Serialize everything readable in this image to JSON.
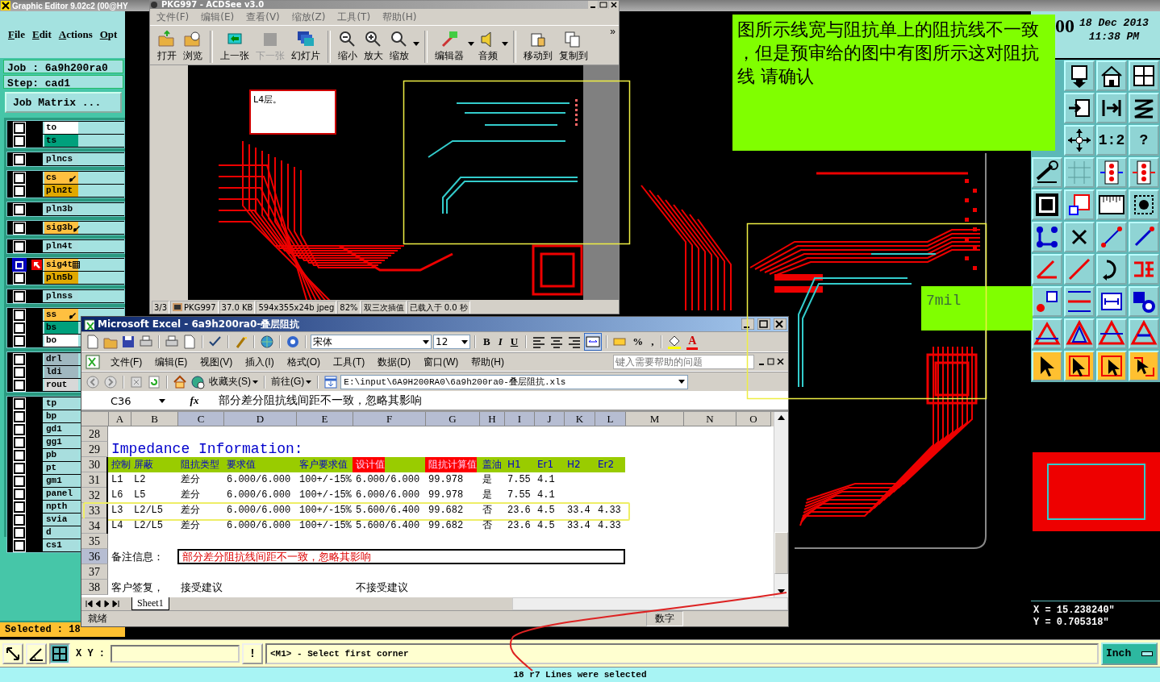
{
  "cad": {
    "title": "Graphic Editor 9.02c2 (00@HY",
    "menu": [
      "File",
      "Edit",
      "Actions",
      "Opt"
    ],
    "clock_fragment": "00",
    "date": "18 Dec 2013",
    "time": "11:38 PM",
    "job": "Job : 6a9h200ra0",
    "step": "Step: cad1",
    "job_matrix": "Job Matrix ...",
    "layer_groups": [
      [
        {
          "name": "to",
          "color": "#ffffff",
          "kind": "plain",
          "selected": false
        },
        {
          "name": "ts",
          "color": "#00a07c",
          "kind": "plain",
          "selected": false
        }
      ],
      [
        {
          "name": "plncs",
          "color": "#a8dede",
          "kind": "plain",
          "selected": false
        }
      ],
      [
        {
          "name": "cs",
          "color": "#ffc040",
          "kind": "pen",
          "selected": false
        },
        {
          "name": "pln2t",
          "color": "#e0a800",
          "kind": "plain",
          "selected": false
        }
      ],
      [
        {
          "name": "pln3b",
          "color": "#a8dede",
          "kind": "plain",
          "selected": false
        }
      ],
      [
        {
          "name": "sig3b",
          "color": "#ffc040",
          "kind": "pen",
          "selected": false
        }
      ],
      [
        {
          "name": "pln4t",
          "color": "#a8dede",
          "kind": "plain",
          "selected": false
        }
      ],
      [
        {
          "name": "sig4t",
          "color": "#ffc040",
          "kind": "grid",
          "selected": true
        },
        {
          "name": "pln5b",
          "color": "#e0a800",
          "kind": "plain",
          "selected": false
        }
      ],
      [
        {
          "name": "plnss",
          "color": "#a8dede",
          "kind": "plain",
          "selected": false
        }
      ],
      [
        {
          "name": "ss",
          "color": "#ffc040",
          "kind": "pen",
          "selected": false
        },
        {
          "name": "bs",
          "color": "#00a07c",
          "kind": "plain",
          "selected": false
        },
        {
          "name": "bo",
          "color": "#ffffff",
          "kind": "plain",
          "selected": false
        }
      ],
      [
        {
          "name": "drl",
          "color": "#a0b8c0",
          "selected": false
        },
        {
          "name": "ldi",
          "color": "#a0b8c0",
          "selected": false
        },
        {
          "name": "rout",
          "color": "#d8d8d8",
          "selected": false
        }
      ],
      [
        {
          "name": "tp",
          "color": "#a8dede",
          "selected": false
        },
        {
          "name": "bp",
          "color": "#a8dede",
          "selected": false
        },
        {
          "name": "gd1",
          "color": "#a8dede",
          "selected": false
        },
        {
          "name": "gg1",
          "color": "#a8dede",
          "selected": false
        },
        {
          "name": "pb",
          "color": "#a8dede",
          "selected": false
        },
        {
          "name": "pt",
          "color": "#a8dede",
          "selected": false
        },
        {
          "name": "gm1",
          "color": "#a8dede",
          "selected": false
        },
        {
          "name": "panel",
          "color": "#a8dede",
          "selected": false
        },
        {
          "name": "npth",
          "color": "#a8dede",
          "selected": false
        },
        {
          "name": "svia",
          "color": "#a8dede",
          "selected": false
        },
        {
          "name": "d",
          "color": "#a8dede",
          "selected": false
        },
        {
          "name": "cs1",
          "color": "#a8dede",
          "selected": false
        }
      ]
    ],
    "tool_labels": {
      "scale": "1:2",
      "help": "?"
    },
    "selected_count": "Selected : 18",
    "x_coord": "X = 15.238240\"",
    "y_coord": "Y = 0.705318\"",
    "xy_label": "X Y :",
    "alert": "!",
    "prompt": "<M1> - Select first corner",
    "units": "Inch",
    "status": "18 r7 Lines were selected"
  },
  "note": {
    "text": "图所示线宽与阻抗单上的阻抗线不一致，但是预审给的图中有图所示这对阻抗线  请确认"
  },
  "width_label": {
    "text": "7mil"
  },
  "acdsee": {
    "title": "PKG997 - ACDSee v3.0",
    "menu": [
      "文件(F)",
      "编辑(E)",
      "查看(V)",
      "缩放(Z)",
      "工具(T)",
      "帮助(H)"
    ],
    "toolbar": [
      {
        "label": "打开",
        "kind": "open",
        "disabled": false
      },
      {
        "label": "浏览",
        "kind": "browse",
        "disabled": false
      },
      {
        "label": "上一张",
        "kind": "prev",
        "disabled": false
      },
      {
        "label": "下一张",
        "kind": "next",
        "disabled": true
      },
      {
        "label": "幻灯片",
        "kind": "slides",
        "disabled": false
      },
      {
        "label": "缩小",
        "kind": "zoomout",
        "disabled": false
      },
      {
        "label": "放大",
        "kind": "zoomin",
        "disabled": false
      },
      {
        "label": "缩放",
        "kind": "zoom",
        "disabled": false
      },
      {
        "label": "编辑器",
        "kind": "editor",
        "disabled": false
      },
      {
        "label": "音频",
        "kind": "audio",
        "disabled": false
      },
      {
        "label": "移动到",
        "kind": "move",
        "disabled": false
      },
      {
        "label": "复制到",
        "kind": "copy",
        "disabled": false
      }
    ],
    "more": "»",
    "image_note": "L4层。",
    "status": [
      "3/3",
      "PKG997",
      "37.0 KB",
      "594x355x24b jpeg",
      "82%",
      "双三次插值",
      "已载入于 0.0 秒"
    ]
  },
  "excel": {
    "title": "Microsoft Excel - 6a9h200ra0-叠层阻抗",
    "font": "宋体",
    "font_size": "12",
    "bold": "B",
    "italic": "I",
    "underline": "U",
    "percent": "%",
    "comma": ",",
    "font_color": "A",
    "menu": [
      "文件(F)",
      "编辑(E)",
      "视图(V)",
      "插入(I)",
      "格式(O)",
      "工具(T)",
      "数据(D)",
      "窗口(W)",
      "帮助(H)"
    ],
    "help_placeholder": "键入需要帮助的问题",
    "favorites": "收藏夹(S)",
    "go": "前往(G)",
    "address": "E:\\input\\6A9H200RA0\\6a9h200ra0-叠层阻抗.xls",
    "name_box": "C36",
    "fx": "fx",
    "formula": "部分差分阻抗线间距不一致，忽略其影响",
    "columns": [
      {
        "label": "A",
        "selected": false
      },
      {
        "label": "B",
        "selected": false
      },
      {
        "label": "C",
        "selected": true
      },
      {
        "label": "D",
        "selected": true
      },
      {
        "label": "E",
        "selected": true
      },
      {
        "label": "F",
        "selected": true
      },
      {
        "label": "G",
        "selected": true
      },
      {
        "label": "H",
        "selected": true
      },
      {
        "label": "I",
        "selected": true
      },
      {
        "label": "J",
        "selected": true
      },
      {
        "label": "K",
        "selected": true
      },
      {
        "label": "L",
        "selected": true
      },
      {
        "label": "M",
        "selected": false
      },
      {
        "label": "N",
        "selected": false
      },
      {
        "label": "O",
        "selected": false
      }
    ],
    "rows": [
      {
        "number": "28",
        "kind": "blank",
        "selected": false,
        "framed": false
      },
      {
        "number": "29",
        "kind": "title",
        "selected": false,
        "framed": false,
        "cells": {
          "A": "Impedance Information:"
        }
      },
      {
        "number": "30",
        "kind": "header",
        "selected": false,
        "framed": false,
        "cells": {
          "A": {
            "text": "控制",
            "highlight": false
          },
          "B": {
            "text": "屏蔽",
            "highlight": false
          },
          "C": {
            "text": "阻抗类型",
            "highlight": false
          },
          "D": {
            "text": "要求值",
            "highlight": false
          },
          "E": {
            "text": "客户要求值",
            "highlight": false
          },
          "F": {
            "text": "设计值",
            "highlight": true
          },
          "G": {
            "text": "阻抗计算值",
            "highlight": true
          },
          "H": {
            "text": "盖油",
            "highlight": false
          },
          "I": {
            "text": "H1",
            "highlight": false
          },
          "J": {
            "text": "Er1",
            "highlight": false
          },
          "K": {
            "text": "H2",
            "highlight": false
          },
          "L": {
            "text": "Er2",
            "highlight": false
          }
        }
      },
      {
        "number": "31",
        "kind": "data",
        "selected": false,
        "framed": false,
        "cells": {
          "A": "L1",
          "B": "L2",
          "C": "差分",
          "D": "6.000/6.000",
          "E": "100+/-15%",
          "F": "6.000/6.000",
          "G": "99.978",
          "H": "是",
          "I": "7.55",
          "J": "4.1"
        }
      },
      {
        "number": "32",
        "kind": "data",
        "selected": false,
        "framed": false,
        "cells": {
          "A": "L6",
          "B": "L5",
          "C": "差分",
          "D": "6.000/6.000",
          "E": "100+/-15%",
          "F": "6.000/6.000",
          "G": "99.978",
          "H": "是",
          "I": "7.55",
          "J": "4.1"
        }
      },
      {
        "number": "33",
        "kind": "data",
        "selected": false,
        "framed": true,
        "cells": {
          "A": "L3",
          "B": "L2/L5",
          "C": "差分",
          "D": "6.000/6.000",
          "E": "100+/-15%",
          "F": "5.600/6.400",
          "G": "99.682",
          "H": "否",
          "I": "23.6",
          "J": "4.5",
          "K": "33.4",
          "L": "4.33"
        }
      },
      {
        "number": "34",
        "kind": "data",
        "selected": false,
        "framed": false,
        "cells": {
          "A": "L4",
          "B": "L2/L5",
          "C": "差分",
          "D": "6.000/6.000",
          "E": "100+/-15%",
          "F": "5.600/6.400",
          "G": "99.682",
          "H": "否",
          "I": "23.6",
          "J": "4.5",
          "K": "33.4",
          "L": "4.33"
        }
      },
      {
        "number": "35",
        "kind": "blank",
        "selected": false,
        "framed": false
      },
      {
        "number": "36",
        "kind": "remark",
        "selected": true,
        "framed": false,
        "cells": {
          "A": "备注信息：",
          "C": "部分差分阻抗线间距不一致，忽略其影响"
        }
      },
      {
        "number": "37",
        "kind": "blank",
        "selected": false,
        "framed": false
      },
      {
        "number": "38",
        "kind": "reply",
        "selected": false,
        "framed": false,
        "cells": {
          "A": "客户签复，",
          "C": "接受建议",
          "F": "不接受建议"
        }
      }
    ],
    "sheet_tab": "Sheet1",
    "status": "就绪",
    "status_mode": "数字"
  }
}
